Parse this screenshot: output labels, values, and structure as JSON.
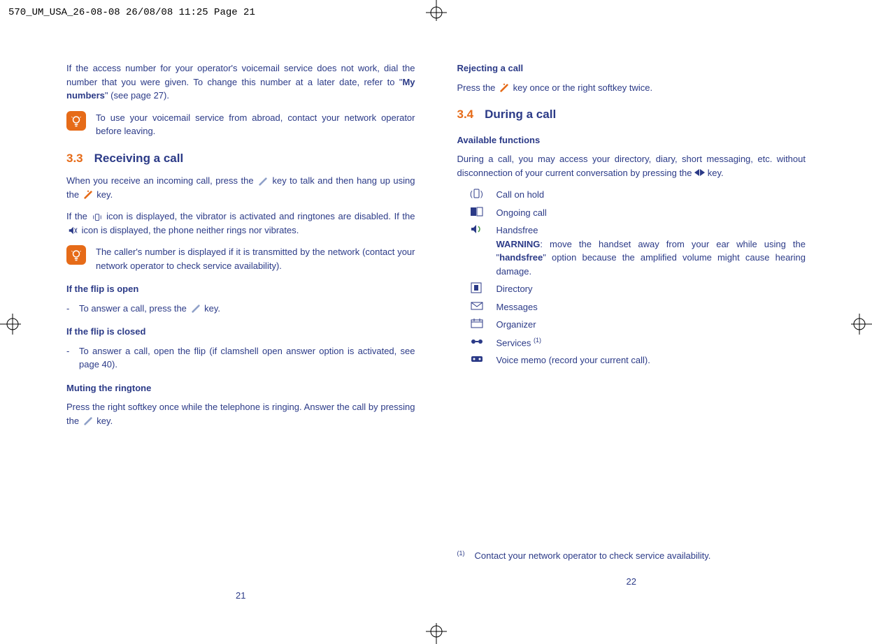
{
  "print_header": "570_UM_USA_26-08-08  26/08/08  11:25  Page 21",
  "left": {
    "para1_a": "If the access number for your operator's voicemail service does not work, dial the number that you were given. To change this number at a later date, refer to \"",
    "para1_b": "My numbers",
    "para1_c": "\" (see page 27).",
    "tip1": "To use your voicemail service from abroad, contact your network operator before leaving.",
    "sec_num": "3.3",
    "sec_title": "Receiving a call",
    "recv1_a": "When you receive an incoming call, press the ",
    "recv1_b": " key to talk and then hang up using the ",
    "recv1_c": " key.",
    "recv2_a": "If the ",
    "recv2_b": " icon is displayed, the vibrator is activated and ringtones are disabled. If the ",
    "recv2_c": " icon is displayed, the phone neither rings nor vibrates.",
    "tip2": "The caller's number is displayed if it is transmitted by the network (contact your network operator to check service availability).",
    "flip_open": "If the flip is open",
    "flip_open_item_a": "To answer a call, press the ",
    "flip_open_item_b": " key.",
    "flip_closed": "If the flip is closed",
    "flip_closed_item": "To answer a call, open the flip (if clamshell open answer option is activated, see page 40).",
    "muting": "Muting the ringtone",
    "muting_para_a": "Press the right softkey once while the telephone is ringing. Answer the call by pressing the ",
    "muting_para_b": " key.",
    "pagenum": "21"
  },
  "right": {
    "reject_h": "Rejecting a call",
    "reject_a": "Press the ",
    "reject_b": " key once or the right softkey twice.",
    "sec_num": "3.4",
    "sec_title": "During a call",
    "avail_h": "Available functions",
    "avail_p_a": "During a call, you may access your directory, diary, short messaging, etc. without disconnection of your current conversation by pressing the ",
    "avail_p_b": " key.",
    "items": {
      "hold": "Call on hold",
      "ongoing": "Ongoing call",
      "handsfree": "Handsfree",
      "warning_label": "WARNING",
      "handsfree_warn_a": ": move the handset away from your ear while using the \"",
      "handsfree_warn_b": "handsfree",
      "handsfree_warn_c": "\" option because the amplified volume might cause hearing damage.",
      "directory": "Directory",
      "messages": "Messages",
      "organizer": "Organizer",
      "services": "Services",
      "services_note_mark": "(1)",
      "voicememo": "Voice memo (record your current call)."
    },
    "footnote_mark": "(1)",
    "footnote_text": "Contact your network operator to check service availability.",
    "pagenum": "22"
  }
}
